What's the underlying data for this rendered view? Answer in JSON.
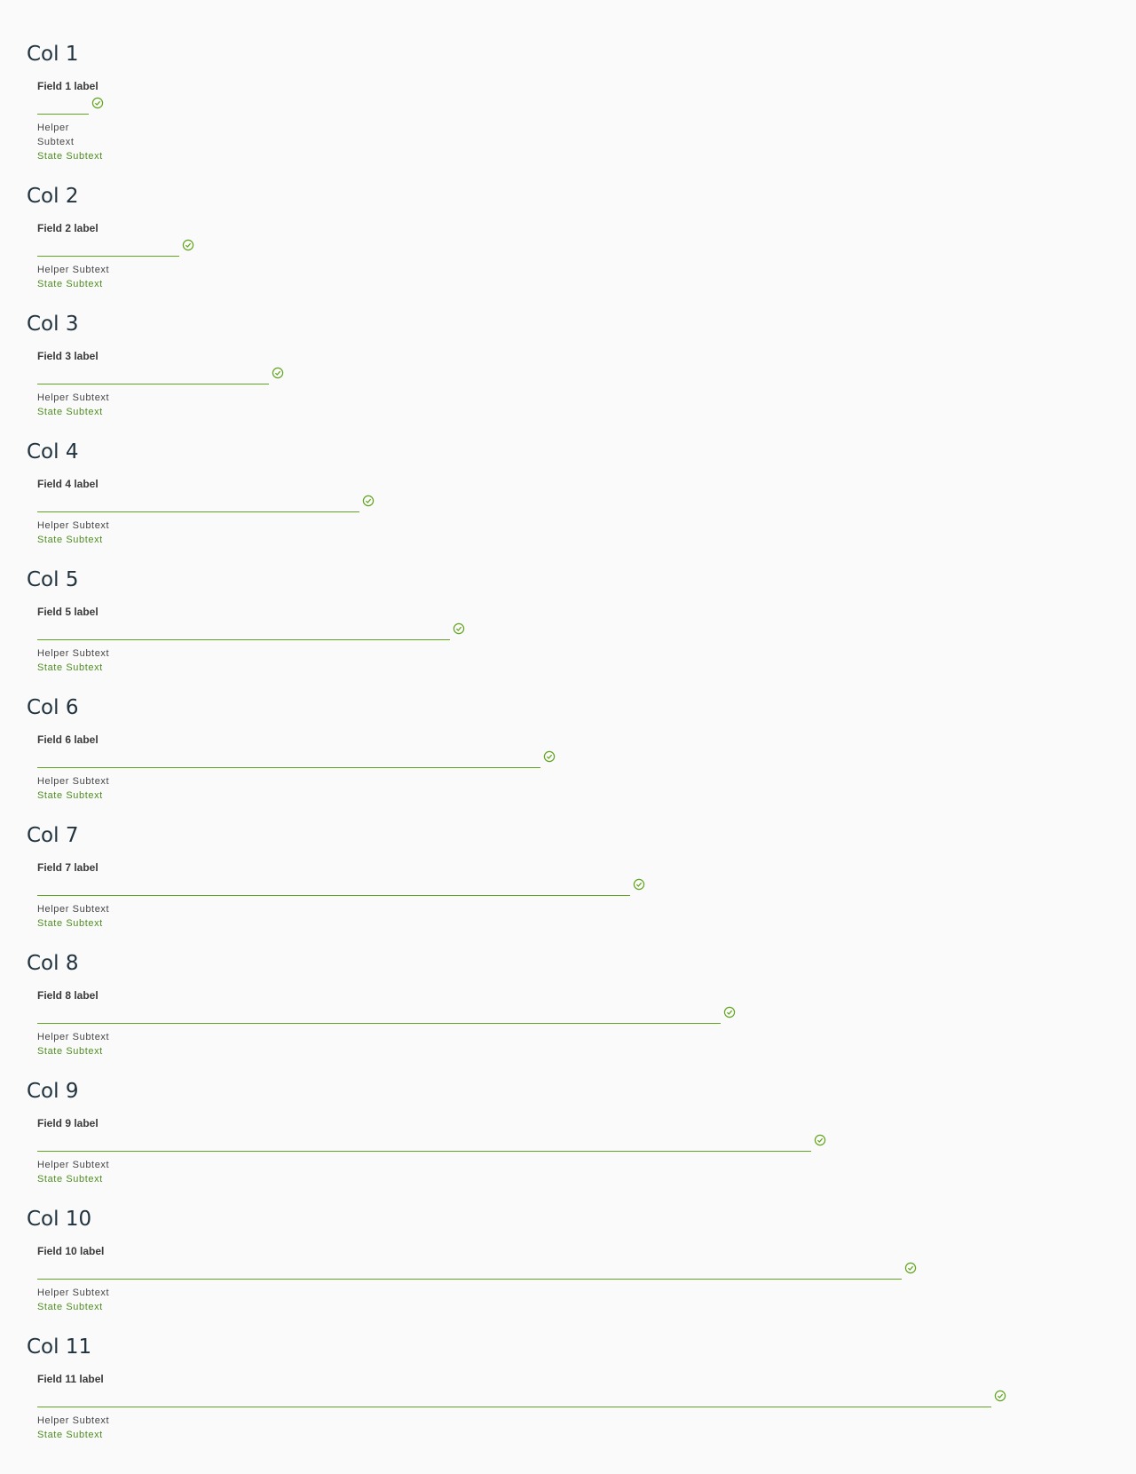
{
  "colors": {
    "success": "#62a420",
    "state_text": "#4e8d1f",
    "heading": "#21333f"
  },
  "sections": [
    {
      "title": "Col 1",
      "field_label": "Field 1 label",
      "value": "",
      "helper": "Helper Subtext",
      "state": "State Subtext",
      "icon": "success-check-icon"
    },
    {
      "title": "Col 2",
      "field_label": "Field 2 label",
      "value": "",
      "helper": "Helper Subtext",
      "state": "State Subtext",
      "icon": "success-check-icon"
    },
    {
      "title": "Col 3",
      "field_label": "Field 3 label",
      "value": "",
      "helper": "Helper Subtext",
      "state": "State Subtext",
      "icon": "success-check-icon"
    },
    {
      "title": "Col 4",
      "field_label": "Field 4 label",
      "value": "",
      "helper": "Helper Subtext",
      "state": "State Subtext",
      "icon": "success-check-icon"
    },
    {
      "title": "Col 5",
      "field_label": "Field 5 label",
      "value": "",
      "helper": "Helper Subtext",
      "state": "State Subtext",
      "icon": "success-check-icon"
    },
    {
      "title": "Col 6",
      "field_label": "Field 6 label",
      "value": "",
      "helper": "Helper Subtext",
      "state": "State Subtext",
      "icon": "success-check-icon"
    },
    {
      "title": "Col 7",
      "field_label": "Field 7 label",
      "value": "",
      "helper": "Helper Subtext",
      "state": "State Subtext",
      "icon": "success-check-icon"
    },
    {
      "title": "Col 8",
      "field_label": "Field 8 label",
      "value": "",
      "helper": "Helper Subtext",
      "state": "State Subtext",
      "icon": "success-check-icon"
    },
    {
      "title": "Col 9",
      "field_label": "Field 9 label",
      "value": "",
      "helper": "Helper Subtext",
      "state": "State Subtext",
      "icon": "success-check-icon"
    },
    {
      "title": "Col 10",
      "field_label": "Field 10 label",
      "value": "",
      "helper": "Helper Subtext",
      "state": "State Subtext",
      "icon": "success-check-icon"
    },
    {
      "title": "Col 11",
      "field_label": "Field 11 label",
      "value": "",
      "helper": "Helper Subtext",
      "state": "State Subtext",
      "icon": "success-check-icon"
    }
  ]
}
